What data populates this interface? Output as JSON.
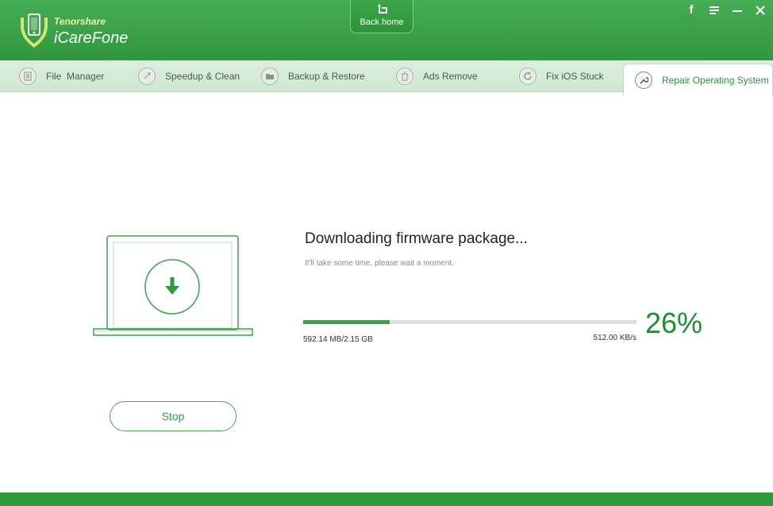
{
  "app": {
    "brand_top": "Tenorshare",
    "brand_name": "iCareFone",
    "logo_icon": "phone-shield-icon"
  },
  "header": {
    "back_home_label": "Back home",
    "window_controls": [
      "facebook-icon",
      "menu-icon",
      "minimize-icon",
      "close-icon"
    ]
  },
  "tabs": [
    {
      "label": "File  Manager",
      "icon": "file-manager-icon",
      "active": false
    },
    {
      "label": "Speedup & Clean",
      "icon": "rocket-icon",
      "active": false
    },
    {
      "label": "Backup & Restore",
      "icon": "folder-icon",
      "active": false
    },
    {
      "label": "Ads Remove",
      "icon": "trash-icon",
      "active": false
    },
    {
      "label": "Fix iOS Stuck",
      "icon": "refresh-icon",
      "active": false
    },
    {
      "label": "Repair Operating System",
      "icon": "wrench-icon",
      "active": true
    }
  ],
  "download": {
    "title": "Downloading firmware package...",
    "subtitle": "It'll take some time, please wait a moment.",
    "progress_percent": 26,
    "percent_label": "26%",
    "size_text": "592.14 MB/2.15 GB",
    "speed_text": "512.00 KB/s"
  },
  "actions": {
    "stop_label": "Stop"
  },
  "colors": {
    "brand_green": "#3aa34a",
    "header_green": "#31973f",
    "percent_green": "#1f8e2e"
  }
}
